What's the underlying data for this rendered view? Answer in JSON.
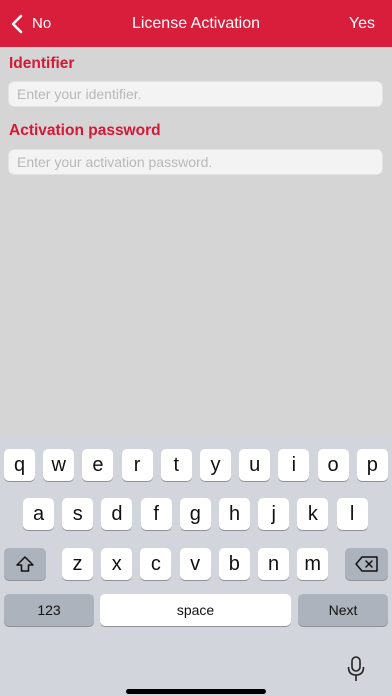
{
  "navbar": {
    "back_label": "No",
    "title": "License Activation",
    "confirm_label": "Yes",
    "color": "#d81e3a"
  },
  "form": {
    "identifier_label": "Identifier",
    "identifier_placeholder": "Enter your identifier.",
    "identifier_value": "",
    "password_label": "Activation password",
    "password_placeholder": "Enter your activation password.",
    "password_value": "",
    "label_color": "#d41836"
  },
  "keyboard": {
    "row1": [
      "q",
      "w",
      "e",
      "r",
      "t",
      "y",
      "u",
      "i",
      "o",
      "p"
    ],
    "row2": [
      "a",
      "s",
      "d",
      "f",
      "g",
      "h",
      "j",
      "k",
      "l"
    ],
    "row3": [
      "z",
      "x",
      "c",
      "v",
      "b",
      "n",
      "m"
    ],
    "numbers_label": "123",
    "space_label": "space",
    "next_label": "Next",
    "shift_icon": "shift-icon",
    "delete_icon": "backspace-icon",
    "mic_icon": "microphone-icon"
  }
}
